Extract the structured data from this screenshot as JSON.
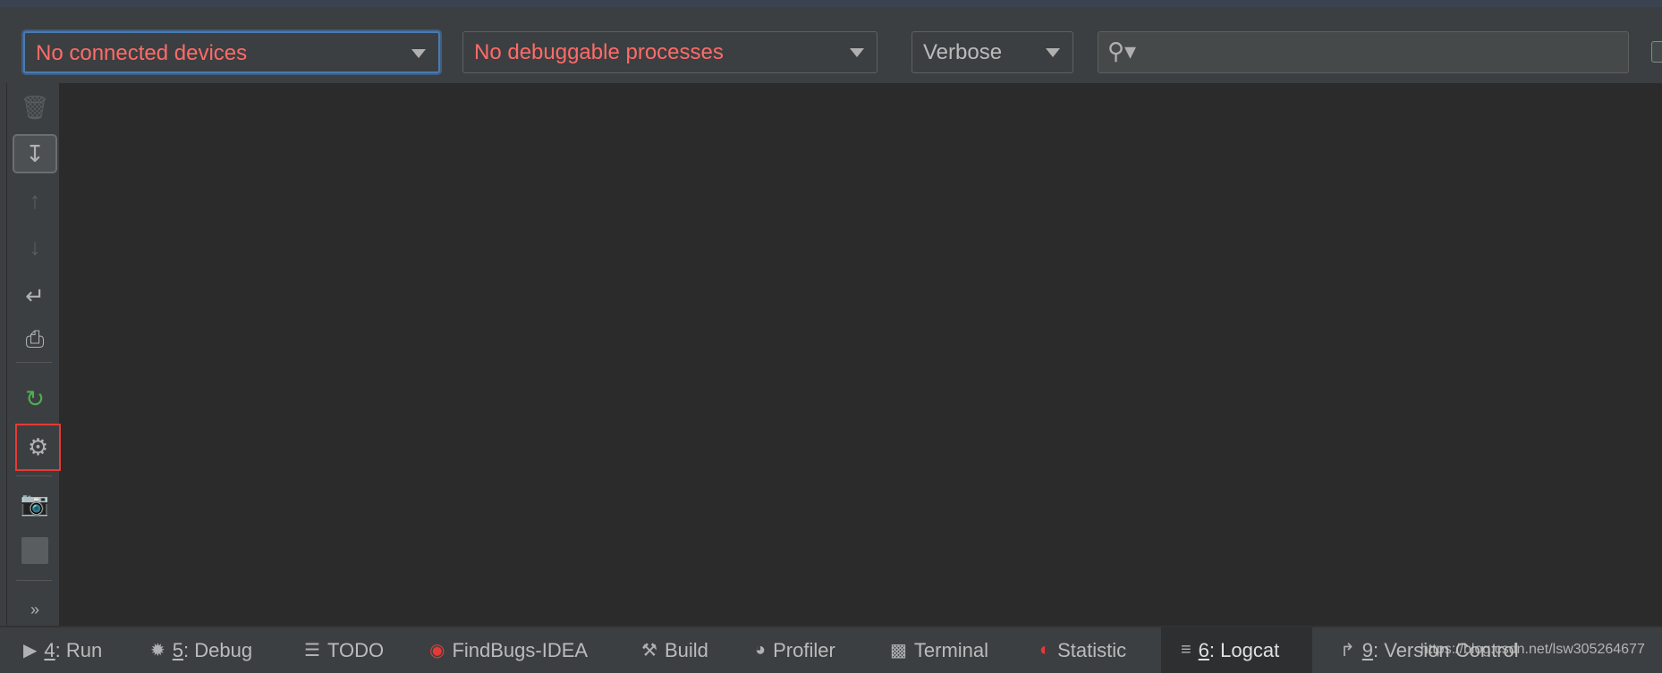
{
  "toolbar": {
    "device_select": "No connected devices",
    "process_select": "No debuggable processes",
    "log_level": "Verbose",
    "search_value": "",
    "error_color": "#ff6b68"
  },
  "sidebar": {
    "icons": [
      "trash-icon",
      "scroll-to-end-icon",
      "up-arrow-icon",
      "down-arrow-icon",
      "soft-wrap-icon",
      "print-icon",
      "restart-icon",
      "gear-icon",
      "camera-icon",
      "stop-icon",
      "more-icon"
    ]
  },
  "bottom_tabs": [
    {
      "num": "4",
      "label": ": Run"
    },
    {
      "num": "5",
      "label": ": Debug"
    },
    {
      "num": "",
      "label": "TODO"
    },
    {
      "num": "",
      "label": "FindBugs-IDEA"
    },
    {
      "num": "",
      "label": "Build"
    },
    {
      "num": "",
      "label": "Profiler"
    },
    {
      "num": "",
      "label": "Terminal"
    },
    {
      "num": "",
      "label": "Statistic"
    },
    {
      "num": "6",
      "label": ": Logcat"
    },
    {
      "num": "9",
      "label": ": Version Control"
    }
  ],
  "watermark": "https://blog.csdn.net/lsw305264677"
}
